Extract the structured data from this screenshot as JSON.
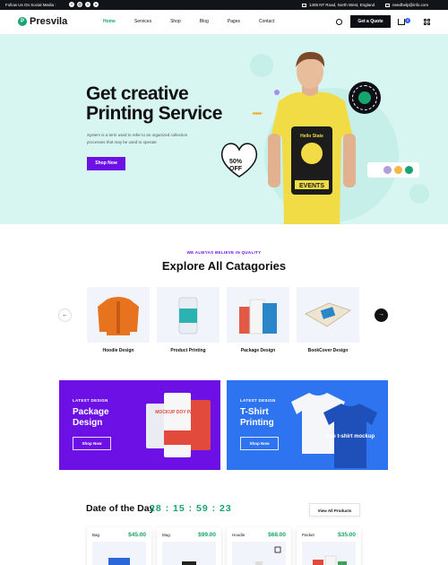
{
  "topbar": {
    "follow_text": "Follow Us On Social Media :",
    "socials": [
      "f",
      "◎",
      "t",
      "v"
    ],
    "address": "1405 NT Road, North West, England",
    "email": "needhelp@info.com"
  },
  "header": {
    "logo_mark": "P",
    "logo_text": "Presvila",
    "nav": [
      "Home",
      "Services",
      "Shop",
      "Blog",
      "Pages",
      "Contact"
    ],
    "nav_active": "Home",
    "quote_button": "Get a Quote",
    "cart_count": "0"
  },
  "hero": {
    "title_line1": "Get creative",
    "title_line2": "Printing Service",
    "description": "System is a term used to refer to an organized collection processes that may be used to operate",
    "button": "Shop Now",
    "arrows": "▸▸▸▸▸",
    "discount_line1": "50%",
    "discount_line2": "OFF",
    "shirt_text_top": "Hello State",
    "shirt_text_bottom": "EVENTS",
    "swatch_colors": [
      "#b39ddb",
      "#f5b942",
      "#17a56f"
    ]
  },
  "categories": {
    "kicker": "WE ALWYAS BELIEVE IN QUALITY",
    "title": "Explore All Catagories",
    "items": [
      "Hoodie Design",
      "Product Printing",
      "Package Design",
      "BookCover Design"
    ]
  },
  "promos": [
    {
      "kicker": "LATEST DESIGN",
      "title": "Package Design",
      "button": "Shop Now",
      "pack_text": "MOCKUP DOY PACK"
    },
    {
      "kicker": "LATEST DESIGN",
      "title": "T-Shirt Printing",
      "button": "Shop Now",
      "shirt_text": "free t-shirt mockup"
    }
  ],
  "deal": {
    "title": "Date of the Day",
    "timer": "28 : 15 : 59 : 23",
    "view_all": "View All Products",
    "products": [
      {
        "name": "Bag",
        "price": "$45.00"
      },
      {
        "name": "Mug",
        "price": "$99.00"
      },
      {
        "name": "Hoodie",
        "price": "$68.00"
      },
      {
        "name": "Packet",
        "price": "$35.00"
      }
    ]
  },
  "colors": {
    "accent_green": "#17a56f",
    "accent_purple": "#6c10e6",
    "accent_blue": "#2e73f0",
    "hero_bg": "#d7f6f1"
  }
}
